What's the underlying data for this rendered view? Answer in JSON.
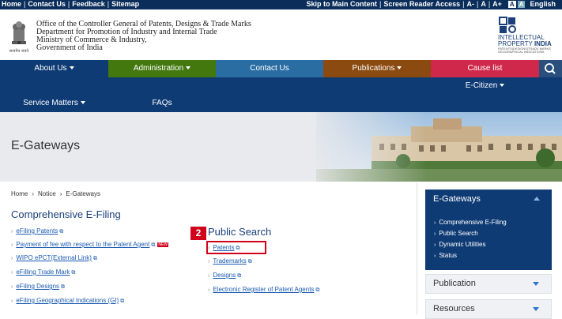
{
  "topbar": {
    "left_links": [
      "Home",
      "Contact Us",
      "Feedback",
      "Sitemap"
    ],
    "skip": "Skip to Main Content",
    "reader": "Screen Reader Access",
    "font_small": "A-",
    "font_normal": "A",
    "font_large": "A+",
    "contrast": "A",
    "language": "English"
  },
  "org": {
    "line1": "Office of the Controller General of Patents, Designs & Trade Marks",
    "line2": "Department for Promotion of Industry and Internal Trade",
    "line3": "Ministry of Commerce & Industry,",
    "line4": "Government of India",
    "emblem_motto": "सत्यमेव जयते"
  },
  "iplogo": {
    "line1": "INTELLECTUAL",
    "line2a": "PROPERTY ",
    "line2b": "INDIA",
    "line3": "PATENTS|DESIGNS|TRADE MARKS",
    "line4": "GEOGRAPHICAL INDICATIONS"
  },
  "nav": {
    "about": "About Us",
    "admin": "Administration",
    "contact": "Contact Us",
    "publications": "Publications",
    "causelist": "Cause list",
    "ecitizen": "E-Citizen",
    "service": "Service Matters",
    "faqs": "FAQs",
    "colors": {
      "bar": "#0e3b74",
      "admin": "#43780f",
      "contact": "#2a6da3",
      "publications": "#8a4a10",
      "causelist": "#d0284a"
    }
  },
  "banner": {
    "title": "E-Gateways"
  },
  "breadcrumb": [
    "Home",
    "›",
    "Notice",
    "›",
    "E-Gateways"
  ],
  "efiling": {
    "heading": "Comprehensive E-Filing",
    "items": [
      "eFiling Patents",
      "Payment of fee with respect to the Patent Agent",
      "WIPO ePCT(External Link)",
      "eFilling Trade Mark",
      "eFiling Designs",
      "eFiling Geographical Indications (GI)"
    ],
    "new_badge": "NEW"
  },
  "public_search": {
    "heading": "Public Search",
    "marker": "2",
    "items": [
      "Patents",
      "Trademarks",
      "Designs",
      "Electronic Register of Patent Agents"
    ]
  },
  "sidebar": {
    "head": "E-Gateways",
    "items": [
      "Comprehensive E-Filing",
      "Public Search",
      "Dynamic Utilities",
      "Status"
    ],
    "publication": "Publication",
    "resources": "Resources"
  }
}
